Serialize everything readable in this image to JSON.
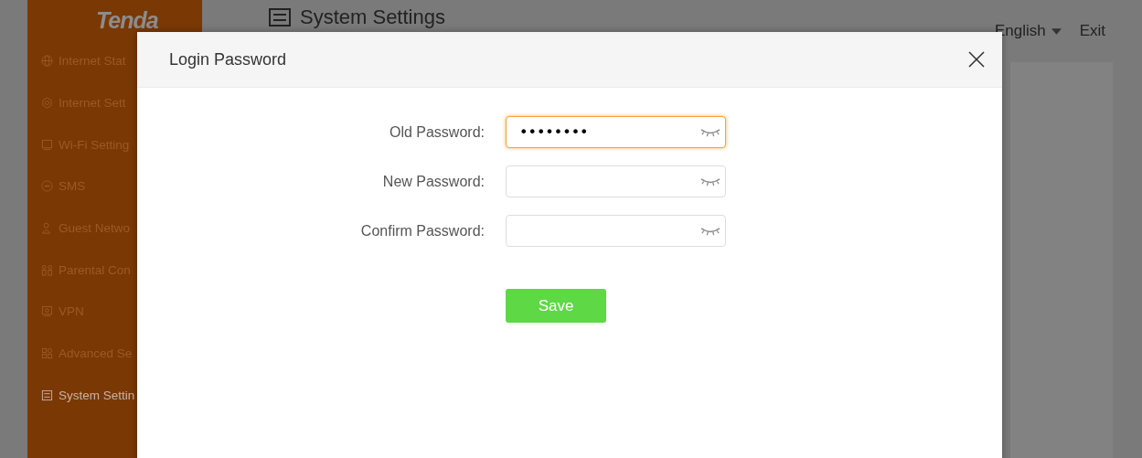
{
  "logo": "Tenda",
  "sidebar": {
    "items": [
      {
        "label": "Internet Stat",
        "selected": false
      },
      {
        "label": "Internet Sett",
        "selected": false
      },
      {
        "label": "Wi-Fi Setting",
        "selected": false
      },
      {
        "label": "SMS",
        "selected": false
      },
      {
        "label": "Guest Netwo",
        "selected": false
      },
      {
        "label": "Parental Con",
        "selected": false
      },
      {
        "label": "VPN",
        "selected": false
      },
      {
        "label": "Advanced Se",
        "selected": false
      },
      {
        "label": "System Settin",
        "selected": true
      }
    ]
  },
  "header": {
    "title": "System Settings",
    "language": "English",
    "exit": "Exit"
  },
  "dialog": {
    "title": "Login Password",
    "fields": [
      {
        "label": "Old Password:",
        "value": "••••••••",
        "focused": true
      },
      {
        "label": "New Password:",
        "focused": false
      },
      {
        "label": "Confirm Password:",
        "focused": false
      }
    ],
    "save": "Save"
  }
}
